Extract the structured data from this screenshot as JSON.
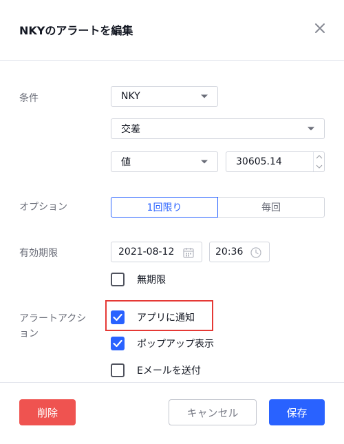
{
  "dialog": {
    "title": "NKYのアラートを編集"
  },
  "condition": {
    "label": "条件",
    "symbol": "NKY",
    "operator": "交差",
    "type": "値",
    "value": "30605.14"
  },
  "option": {
    "label": "オプション",
    "choices": [
      "1回限り",
      "毎回"
    ],
    "selected": "1回限り"
  },
  "expiry": {
    "label": "有効期限",
    "date": "2021-08-12",
    "time": "20:36",
    "unlimited_label": "無期限",
    "unlimited_checked": false
  },
  "actions": {
    "label_line1": "アラートアクシ",
    "label_line2": "ョン",
    "items": [
      {
        "label": "アプリに通知",
        "checked": true
      },
      {
        "label": "ポップアップ表示",
        "checked": true
      },
      {
        "label": "Eメールを送付",
        "checked": false
      }
    ]
  },
  "footer": {
    "delete_label": "削除",
    "cancel_label": "キャンセル",
    "save_label": "保存"
  },
  "colors": {
    "accent": "#2962ff",
    "danger": "#ef5350",
    "highlight": "#e53935"
  },
  "icons": [
    "close-icon",
    "caret-down-icon",
    "calendar-icon",
    "clock-icon",
    "checkmark-icon"
  ]
}
